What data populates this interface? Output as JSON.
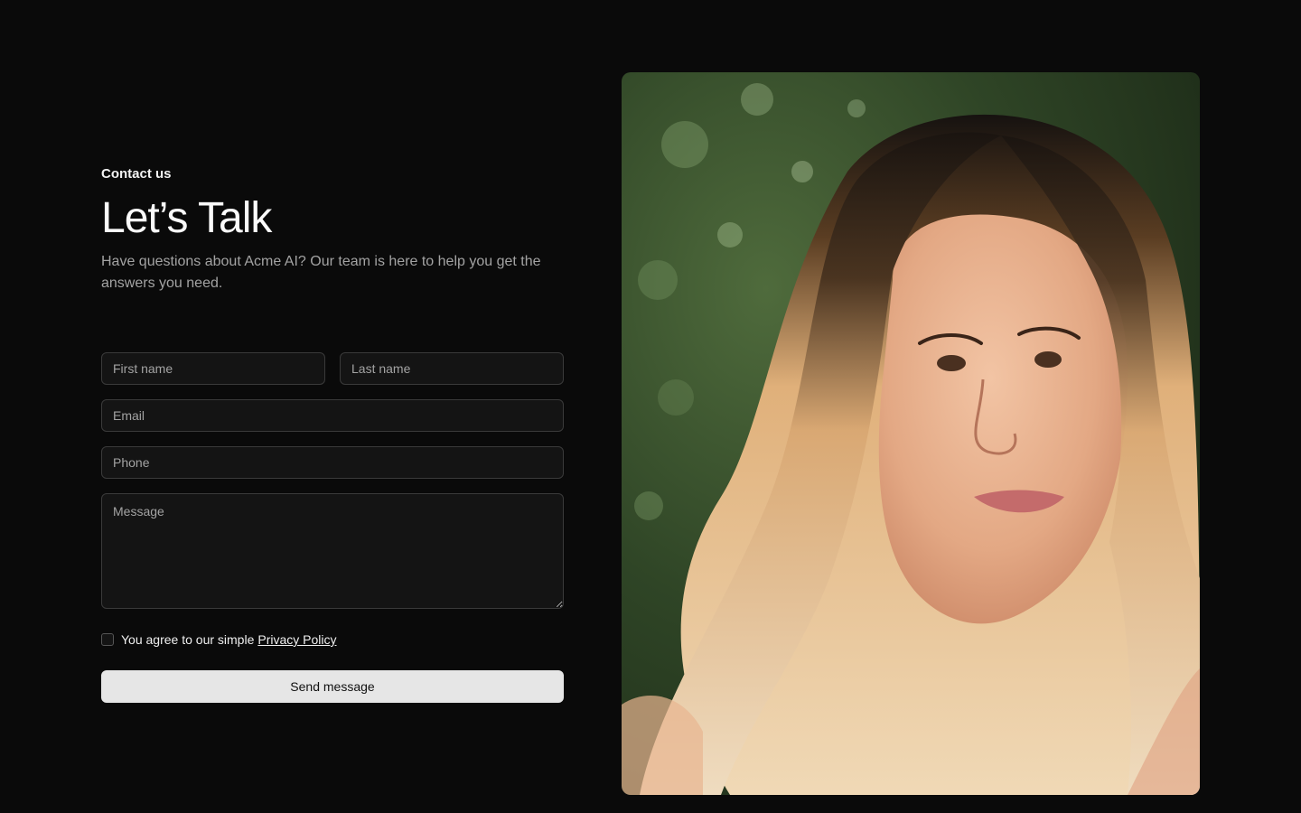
{
  "contact": {
    "eyebrow": "Contact us",
    "title": "Let’s Talk",
    "subtitle": "Have questions about Acme AI? Our team is here to help you get the answers you need."
  },
  "form": {
    "first_name_placeholder": "First name",
    "last_name_placeholder": "Last name",
    "email_placeholder": "Email",
    "phone_placeholder": "Phone",
    "message_placeholder": "Message",
    "consent_text": "You agree to our simple",
    "privacy_link": "Privacy Policy",
    "submit_label": "Send message"
  },
  "colors": {
    "background": "#0a0a0a",
    "field_bg": "#141414",
    "field_border": "#3a3a3a",
    "button_bg": "#e6e6e6"
  }
}
